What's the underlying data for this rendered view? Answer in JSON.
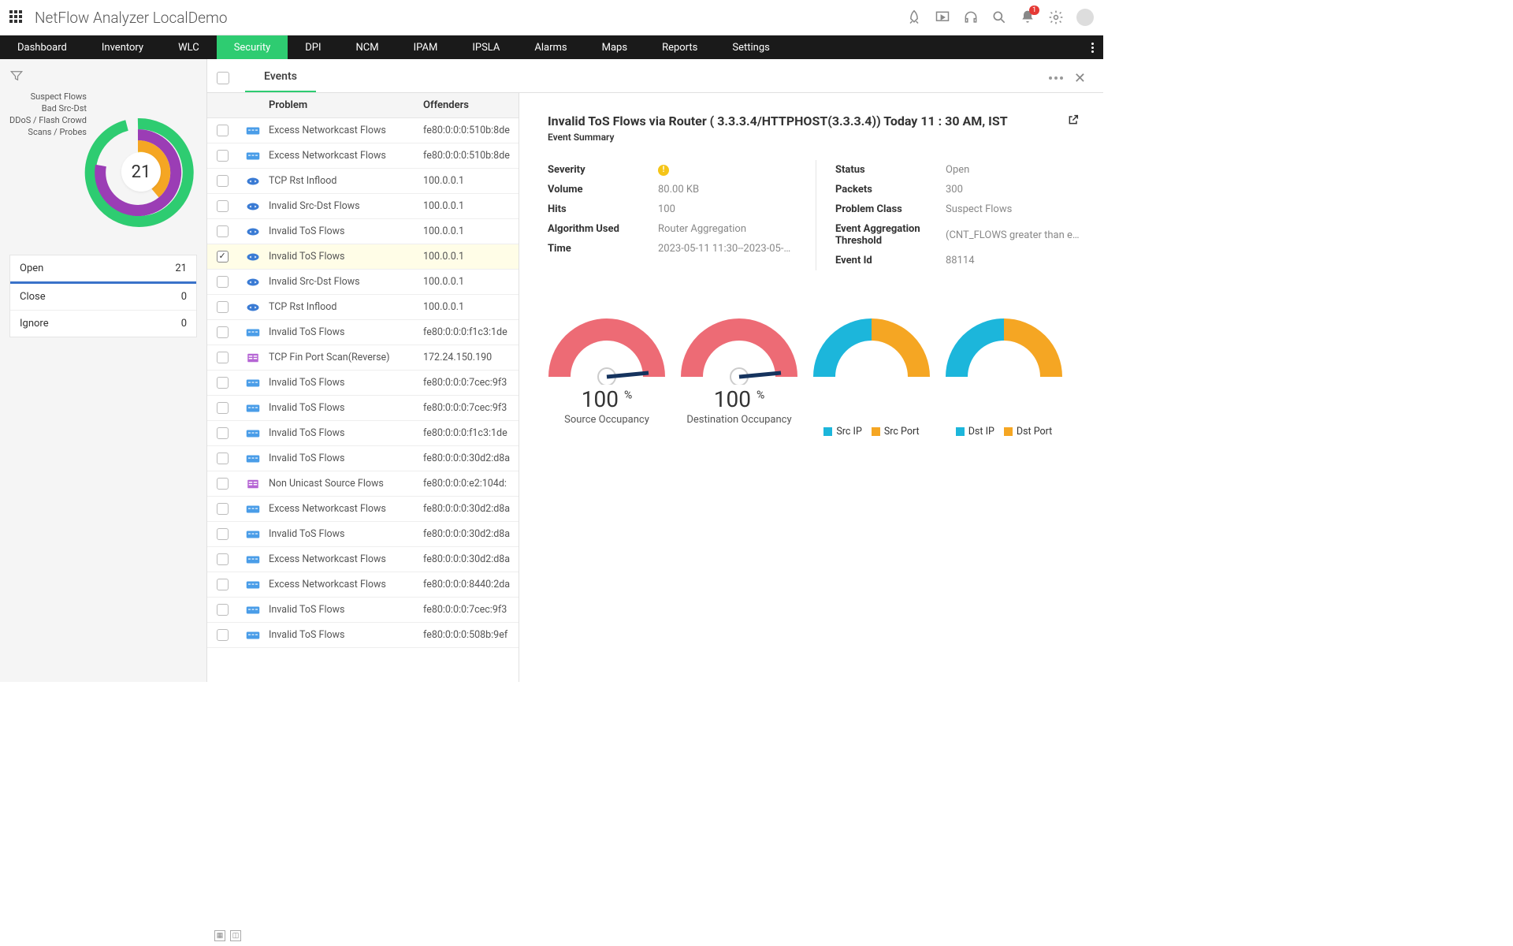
{
  "app_title": "NetFlow Analyzer LocalDemo",
  "notification_count": "1",
  "nav": [
    "Dashboard",
    "Inventory",
    "WLC",
    "Security",
    "DPI",
    "NCM",
    "IPAM",
    "IPSLA",
    "Alarms",
    "Maps",
    "Reports",
    "Settings"
  ],
  "nav_active": 3,
  "donut_legend": [
    "Suspect Flows",
    "Bad Src-Dst",
    "DDoS / Flash Crowd",
    "Scans / Probes"
  ],
  "donut_center": "21",
  "status_rows": [
    {
      "label": "Open",
      "count": "21"
    },
    {
      "label": "Close",
      "count": "0"
    },
    {
      "label": "Ignore",
      "count": "0"
    }
  ],
  "tab_label": "Events",
  "columns": {
    "problem": "Problem",
    "offender": "Offenders"
  },
  "events": [
    {
      "icon": "switch",
      "problem": "Excess Networkcast Flows",
      "offender": "fe80:0:0:0:510b:8de",
      "selected": false
    },
    {
      "icon": "switch",
      "problem": "Excess Networkcast Flows",
      "offender": "fe80:0:0:0:510b:8de",
      "selected": false
    },
    {
      "icon": "router",
      "problem": "TCP Rst Inflood",
      "offender": "100.0.0.1",
      "selected": false
    },
    {
      "icon": "router",
      "problem": "Invalid Src-Dst Flows",
      "offender": "100.0.0.1",
      "selected": false
    },
    {
      "icon": "router",
      "problem": "Invalid ToS Flows",
      "offender": "100.0.0.1",
      "selected": false
    },
    {
      "icon": "router",
      "problem": "Invalid ToS Flows",
      "offender": "100.0.0.1",
      "selected": true
    },
    {
      "icon": "router",
      "problem": "Invalid Src-Dst Flows",
      "offender": "100.0.0.1",
      "selected": false
    },
    {
      "icon": "router",
      "problem": "TCP Rst Inflood",
      "offender": "100.0.0.1",
      "selected": false
    },
    {
      "icon": "switch",
      "problem": "Invalid ToS Flows",
      "offender": "fe80:0:0:0:f1c3:1de",
      "selected": false
    },
    {
      "icon": "firewall",
      "problem": "TCP Fin Port Scan(Reverse)",
      "offender": "172.24.150.190",
      "selected": false
    },
    {
      "icon": "switch",
      "problem": "Invalid ToS Flows",
      "offender": "fe80:0:0:0:7cec:9f3",
      "selected": false
    },
    {
      "icon": "switch",
      "problem": "Invalid ToS Flows",
      "offender": "fe80:0:0:0:7cec:9f3",
      "selected": false
    },
    {
      "icon": "switch",
      "problem": "Invalid ToS Flows",
      "offender": "fe80:0:0:0:f1c3:1de",
      "selected": false
    },
    {
      "icon": "switch",
      "problem": "Invalid ToS Flows",
      "offender": "fe80:0:0:0:30d2:d8a",
      "selected": false
    },
    {
      "icon": "firewall",
      "problem": "Non Unicast Source Flows",
      "offender": "fe80:0:0:0:e2:104d:",
      "selected": false
    },
    {
      "icon": "switch",
      "problem": "Excess Networkcast Flows",
      "offender": "fe80:0:0:0:30d2:d8a",
      "selected": false
    },
    {
      "icon": "switch",
      "problem": "Invalid ToS Flows",
      "offender": "fe80:0:0:0:30d2:d8a",
      "selected": false
    },
    {
      "icon": "switch",
      "problem": "Excess Networkcast Flows",
      "offender": "fe80:0:0:0:30d2:d8a",
      "selected": false
    },
    {
      "icon": "switch",
      "problem": "Excess Networkcast Flows",
      "offender": "fe80:0:0:0:8440:2da",
      "selected": false
    },
    {
      "icon": "switch",
      "problem": "Invalid ToS Flows",
      "offender": "fe80:0:0:0:7cec:9f3",
      "selected": false
    },
    {
      "icon": "switch",
      "problem": "Invalid ToS Flows",
      "offender": "fe80:0:0:0:508b:9ef",
      "selected": false
    }
  ],
  "detail": {
    "title": "Invalid ToS Flows via Router ( 3.3.3.4/HTTPHOST(3.3.3.4)) Today 11 : 30 AM, IST",
    "subtitle": "Event Summary",
    "left": [
      {
        "label": "Severity",
        "value": "!"
      },
      {
        "label": "Volume",
        "value": "80.00 KB"
      },
      {
        "label": "Hits",
        "value": "100"
      },
      {
        "label": "Algorithm Used",
        "value": "Router Aggregation"
      },
      {
        "label": "Time",
        "value": "2023-05-11 11:30--2023-05-…"
      }
    ],
    "right": [
      {
        "label": "Status",
        "value": "Open"
      },
      {
        "label": "Packets",
        "value": "300"
      },
      {
        "label": "Problem Class",
        "value": "Suspect Flows"
      },
      {
        "label": "Event Aggregation Threshold",
        "value": "(CNT_FLOWS greater than e…"
      },
      {
        "label": "Event Id",
        "value": "88114"
      }
    ]
  },
  "gauges": {
    "g1": {
      "value": "100",
      "label": "Source Occupancy"
    },
    "g2": {
      "value": "100",
      "label": "Destination Occupancy"
    },
    "legend1": [
      {
        "color": "#1cb6db",
        "label": "Src IP"
      },
      {
        "color": "#f5a623",
        "label": "Src Port"
      }
    ],
    "legend2": [
      {
        "color": "#1cb6db",
        "label": "Dst IP"
      },
      {
        "color": "#f5a623",
        "label": "Dst Port"
      }
    ]
  },
  "chart_data": [
    {
      "type": "gauge",
      "title": "Source Occupancy",
      "value": 100,
      "unit": "%",
      "range": [
        0,
        100
      ],
      "color": "#ed6b75"
    },
    {
      "type": "gauge",
      "title": "Destination Occupancy",
      "value": 100,
      "unit": "%",
      "range": [
        0,
        100
      ],
      "color": "#ed6b75"
    },
    {
      "type": "pie",
      "title": "Src IP/Port split",
      "series": [
        {
          "name": "Src IP",
          "value": 50,
          "color": "#1cb6db"
        },
        {
          "name": "Src Port",
          "value": 50,
          "color": "#f5a623"
        }
      ]
    },
    {
      "type": "pie",
      "title": "Dst IP/Port split",
      "series": [
        {
          "name": "Dst IP",
          "value": 50,
          "color": "#1cb6db"
        },
        {
          "name": "Dst Port",
          "value": 50,
          "color": "#f5a623"
        }
      ]
    },
    {
      "type": "pie",
      "title": "Security event classes",
      "center_value": 21,
      "series": [
        {
          "name": "Suspect Flows",
          "color": "#2ecc71"
        },
        {
          "name": "Bad Src-Dst",
          "color": "#9b3db5"
        },
        {
          "name": "DDoS / Flash Crowd",
          "color": "#f5a623"
        },
        {
          "name": "Scans / Probes",
          "color": "#f5c518"
        }
      ]
    }
  ]
}
